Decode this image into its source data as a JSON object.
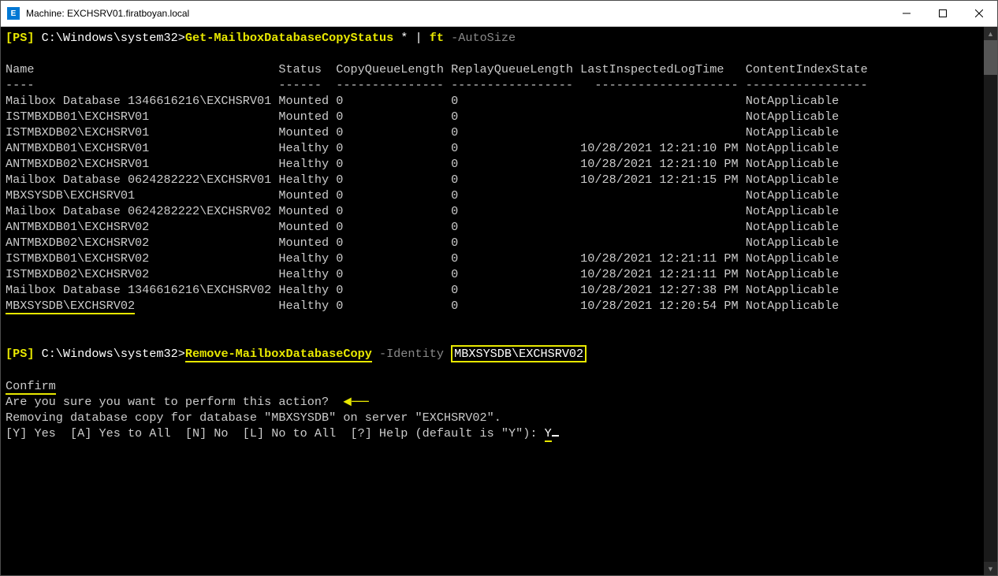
{
  "window": {
    "icon_letter": "E",
    "title": "Machine: EXCHSRV01.firatboyan.local"
  },
  "prompt1": {
    "ps": "[PS]",
    "path": "C:\\Windows\\system32>",
    "cmd": "Get-MailboxDatabaseCopyStatus",
    "star": " *",
    "pipe": " | ",
    "ft": "ft",
    "auto": " -AutoSize"
  },
  "headers": {
    "name": "Name",
    "status": "Status",
    "cql": "CopyQueueLength",
    "rql": "ReplayQueueLength",
    "lilt": "LastInspectedLogTime",
    "cis": "ContentIndexState"
  },
  "dashes": {
    "name": "----",
    "status": "------",
    "cql": "---------------",
    "rql": "-----------------",
    "lilt": "--------------------",
    "cis": "-----------------"
  },
  "rows": [
    {
      "name": "Mailbox Database 1346616216\\EXCHSRV01",
      "status": "Mounted",
      "cql": "0",
      "rql": "0",
      "lilt": "",
      "cis": "NotApplicable"
    },
    {
      "name": "ISTMBXDB01\\EXCHSRV01",
      "status": "Mounted",
      "cql": "0",
      "rql": "0",
      "lilt": "",
      "cis": "NotApplicable"
    },
    {
      "name": "ISTMBXDB02\\EXCHSRV01",
      "status": "Mounted",
      "cql": "0",
      "rql": "0",
      "lilt": "",
      "cis": "NotApplicable"
    },
    {
      "name": "ANTMBXDB01\\EXCHSRV01",
      "status": "Healthy",
      "cql": "0",
      "rql": "0",
      "lilt": "10/28/2021 12:21:10 PM",
      "cis": "NotApplicable"
    },
    {
      "name": "ANTMBXDB02\\EXCHSRV01",
      "status": "Healthy",
      "cql": "0",
      "rql": "0",
      "lilt": "10/28/2021 12:21:10 PM",
      "cis": "NotApplicable"
    },
    {
      "name": "Mailbox Database 0624282222\\EXCHSRV01",
      "status": "Healthy",
      "cql": "0",
      "rql": "0",
      "lilt": "10/28/2021 12:21:15 PM",
      "cis": "NotApplicable"
    },
    {
      "name": "MBXSYSDB\\EXCHSRV01",
      "status": "Mounted",
      "cql": "0",
      "rql": "0",
      "lilt": "",
      "cis": "NotApplicable"
    },
    {
      "name": "Mailbox Database 0624282222\\EXCHSRV02",
      "status": "Mounted",
      "cql": "0",
      "rql": "0",
      "lilt": "",
      "cis": "NotApplicable"
    },
    {
      "name": "ANTMBXDB01\\EXCHSRV02",
      "status": "Mounted",
      "cql": "0",
      "rql": "0",
      "lilt": "",
      "cis": "NotApplicable"
    },
    {
      "name": "ANTMBXDB02\\EXCHSRV02",
      "status": "Mounted",
      "cql": "0",
      "rql": "0",
      "lilt": "",
      "cis": "NotApplicable"
    },
    {
      "name": "ISTMBXDB01\\EXCHSRV02",
      "status": "Healthy",
      "cql": "0",
      "rql": "0",
      "lilt": "10/28/2021 12:21:11 PM",
      "cis": "NotApplicable"
    },
    {
      "name": "ISTMBXDB02\\EXCHSRV02",
      "status": "Healthy",
      "cql": "0",
      "rql": "0",
      "lilt": "10/28/2021 12:21:11 PM",
      "cis": "NotApplicable"
    },
    {
      "name": "Mailbox Database 1346616216\\EXCHSRV02",
      "status": "Healthy",
      "cql": "0",
      "rql": "0",
      "lilt": "10/28/2021 12:27:38 PM",
      "cis": "NotApplicable"
    },
    {
      "name": "MBXSYSDB\\EXCHSRV02",
      "status": "Healthy",
      "cql": "0",
      "rql": "0",
      "lilt": "10/28/2021 12:20:54 PM",
      "cis": "NotApplicable"
    }
  ],
  "prompt2": {
    "ps": "[PS]",
    "path": "C:\\Windows\\system32>",
    "cmd": "Remove-MailboxDatabaseCopy",
    "identity_flag": " -Identity ",
    "identity_val": "MBXSYSDB\\EXCHSRV02"
  },
  "confirm": {
    "title": "Confirm",
    "q": "Are you sure you want to perform this action?",
    "msg": "Removing database copy for database \"MBXSYSDB\" on server \"EXCHSRV02\".",
    "opts": "[Y] Yes  [A] Yes to All  [N] No  [L] No to All  [?] Help (default is \"Y\"): ",
    "answer": "Y"
  }
}
